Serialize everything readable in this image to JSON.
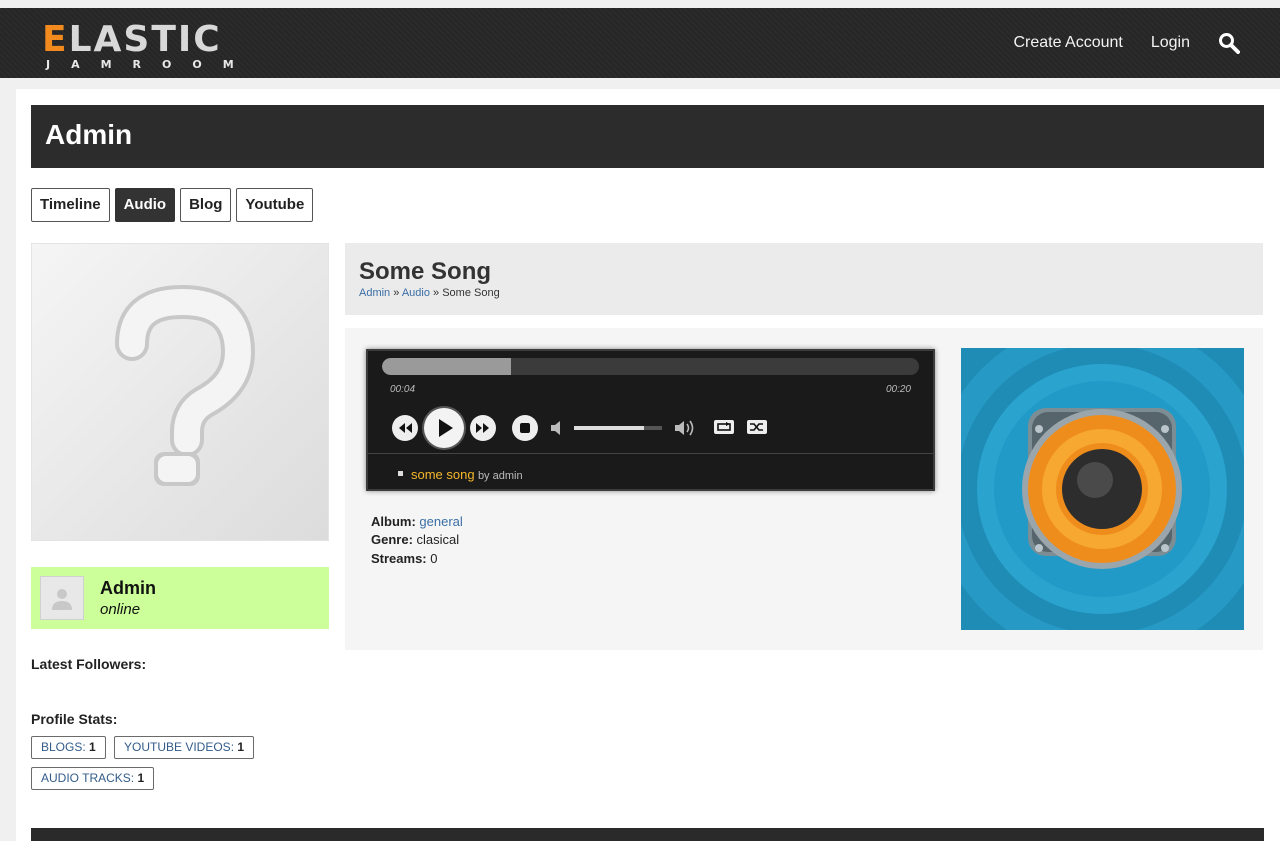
{
  "header": {
    "logo_main_first": "E",
    "logo_main_rest": "LASTIC",
    "logo_sub": "JAMROOM",
    "nav": {
      "create_account": "Create Account",
      "login": "Login"
    },
    "icon": "search-icon"
  },
  "profile": {
    "title": "Admin",
    "tabs": [
      {
        "label": "Timeline",
        "active": false
      },
      {
        "label": "Audio",
        "active": true
      },
      {
        "label": "Blog",
        "active": false
      },
      {
        "label": "Youtube",
        "active": false
      }
    ],
    "user": {
      "name": "Admin",
      "status": "online"
    },
    "latest_followers_heading": "Latest Followers:",
    "stats_heading": "Profile Stats:",
    "stats": [
      {
        "label": "BLOGS:",
        "count": "1"
      },
      {
        "label": "YOUTUBE VIDEOS:",
        "count": "1"
      },
      {
        "label": "AUDIO TRACKS:",
        "count": "1"
      }
    ]
  },
  "song": {
    "title": "Some Song",
    "breadcrumb": {
      "part1": "Admin",
      "sep": "»",
      "part2": "Audio",
      "part3": "Some Song"
    },
    "player": {
      "current_time": "00:04",
      "total_time": "00:20",
      "progress_fraction": 0.24,
      "volume_fraction": 0.8,
      "playlist_title": "some song",
      "playlist_by": "by admin"
    },
    "meta": {
      "album_label": "Album:",
      "album_value": "general",
      "genre_label": "Genre:",
      "genre_value": "clasical",
      "streams_label": "Streams:",
      "streams_value": "0"
    }
  },
  "colors": {
    "accent_orange": "#f28a1e",
    "online_green": "#ccff99",
    "link_blue": "#3a6ea5",
    "playlist_title": "#f5b72a"
  }
}
